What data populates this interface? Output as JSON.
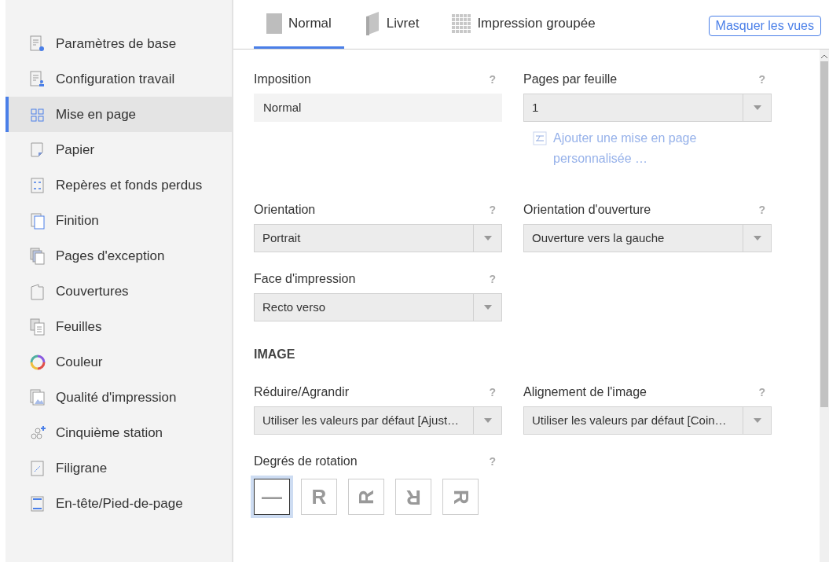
{
  "sidebar": {
    "items": [
      {
        "label": "Paramètres de base",
        "selected": false
      },
      {
        "label": "Configuration travail",
        "selected": false
      },
      {
        "label": "Mise en page",
        "selected": true
      },
      {
        "label": "Papier",
        "selected": false
      },
      {
        "label": "Repères et fonds perdus",
        "selected": false
      },
      {
        "label": "Finition",
        "selected": false
      },
      {
        "label": "Pages d'exception",
        "selected": false
      },
      {
        "label": "Couvertures",
        "selected": false
      },
      {
        "label": "Feuilles",
        "selected": false
      },
      {
        "label": "Couleur",
        "selected": false
      },
      {
        "label": "Qualité d'impression",
        "selected": false
      },
      {
        "label": "Cinquième station",
        "selected": false
      },
      {
        "label": "Filigrane",
        "selected": false
      },
      {
        "label": "En-tête/Pied-de-page",
        "selected": false
      }
    ]
  },
  "tabs": [
    {
      "label": "Normal",
      "selected": true
    },
    {
      "label": "Livret",
      "selected": false
    },
    {
      "label": "Impression groupée",
      "selected": false
    }
  ],
  "hide_views_button": "Masquer les vues",
  "help_mark": "?",
  "fields": [
    {
      "label": "Imposition",
      "kind": "readonly",
      "value": "Normal"
    },
    {
      "label": "Pages par feuille",
      "kind": "select",
      "value": "1",
      "link": "Ajouter une mise en page personnalisée …"
    },
    {
      "label": "Orientation",
      "kind": "select",
      "value": "Portrait"
    },
    {
      "label": "Orientation d'ouverture",
      "kind": "select",
      "value": "Ouverture vers la gauche"
    },
    {
      "label": "Face d'impression",
      "kind": "select",
      "value": "Recto verso"
    }
  ],
  "image_section": {
    "heading": "IMAGE",
    "fields": [
      {
        "label": "Réduire/Agrandir",
        "kind": "select",
        "value": "Utiliser les valeurs par défaut [Ajust…"
      },
      {
        "label": "Alignement de l'image",
        "kind": "select",
        "value": "Utiliser les valeurs par défaut [Coin…"
      }
    ],
    "rotation": {
      "label": "Degrés de rotation",
      "options": [
        {
          "glyph": "—",
          "kind": "upright",
          "selected": true
        },
        {
          "glyph": "R",
          "kind": "upright",
          "selected": false
        },
        {
          "glyph": "R",
          "kind": "left",
          "selected": false
        },
        {
          "glyph": "R",
          "kind": "flipped",
          "selected": false
        },
        {
          "glyph": "R",
          "kind": "right",
          "selected": false
        }
      ]
    }
  }
}
